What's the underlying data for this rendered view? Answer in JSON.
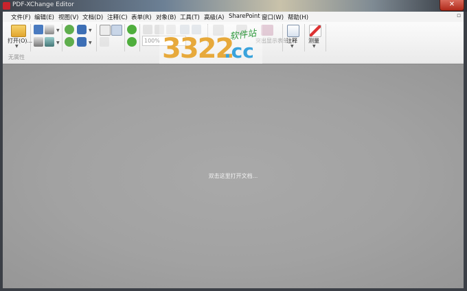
{
  "window": {
    "title": "PDF-XChange Editor",
    "close_glyph": "✕",
    "app_icon": "pdf-xchange-app-icon"
  },
  "menubar": {
    "items": [
      {
        "label": "文件(F)"
      },
      {
        "label": "编辑(E)"
      },
      {
        "label": "视图(V)"
      },
      {
        "label": "文档(D)"
      },
      {
        "label": "注释(C)"
      },
      {
        "label": "表单(R)"
      },
      {
        "label": "对象(B)"
      },
      {
        "label": "工具(T)"
      },
      {
        "label": "高级(A)"
      },
      {
        "label": "SharePoint"
      },
      {
        "label": "窗口(W)"
      },
      {
        "label": "帮助(H)"
      }
    ],
    "restore_glyph": "▫"
  },
  "ribbon": {
    "open_label": "打开(O)...",
    "zoom_value": "100%",
    "highlight_form_label": "突出显示表单",
    "comment_label": "注释",
    "measure_label": "测量",
    "properties_label": "无属性"
  },
  "watermark": {
    "number": "3322",
    "domain": ".cc",
    "tag": "软件站"
  },
  "document": {
    "hint": "双击这里打开文档..."
  },
  "colors": {
    "close_button": "#c0392b",
    "ribbon_bg": "#f3f3f3",
    "document_bg": "#a5a5a5",
    "watermark_orange": "#e7a93b",
    "watermark_blue": "#3aa3dc",
    "watermark_green": "#2e9a3d"
  }
}
